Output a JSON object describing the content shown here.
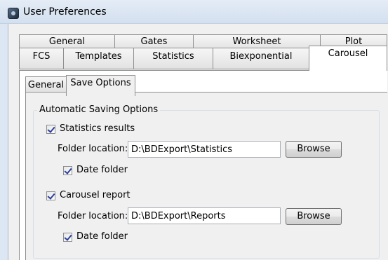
{
  "window": {
    "title": "User Preferences"
  },
  "tabs": {
    "back_row": [
      "General",
      "Gates",
      "Worksheet",
      "Plot"
    ],
    "front_row": [
      "FCS",
      "Templates",
      "Statistics",
      "Biexponential",
      "Carousel"
    ],
    "selected": "Carousel"
  },
  "subtabs": {
    "items": [
      "General",
      "Save Options"
    ],
    "selected": "Save Options"
  },
  "group": {
    "title": "Automatic Saving Options",
    "statistics": {
      "checkbox_label": "Statistics results",
      "checked": true,
      "folder_label": "Folder location:",
      "folder_value": "D:\\BDExport\\Statistics",
      "browse_label": "Browse",
      "date_label": "Date folder",
      "date_checked": true
    },
    "carousel": {
      "checkbox_label": "Carousel report",
      "checked": true,
      "folder_label": "Folder location:",
      "folder_value": "D:\\BDExport\\Reports",
      "browse_label": "Browse",
      "date_label": "Date folder",
      "date_checked": true
    }
  }
}
